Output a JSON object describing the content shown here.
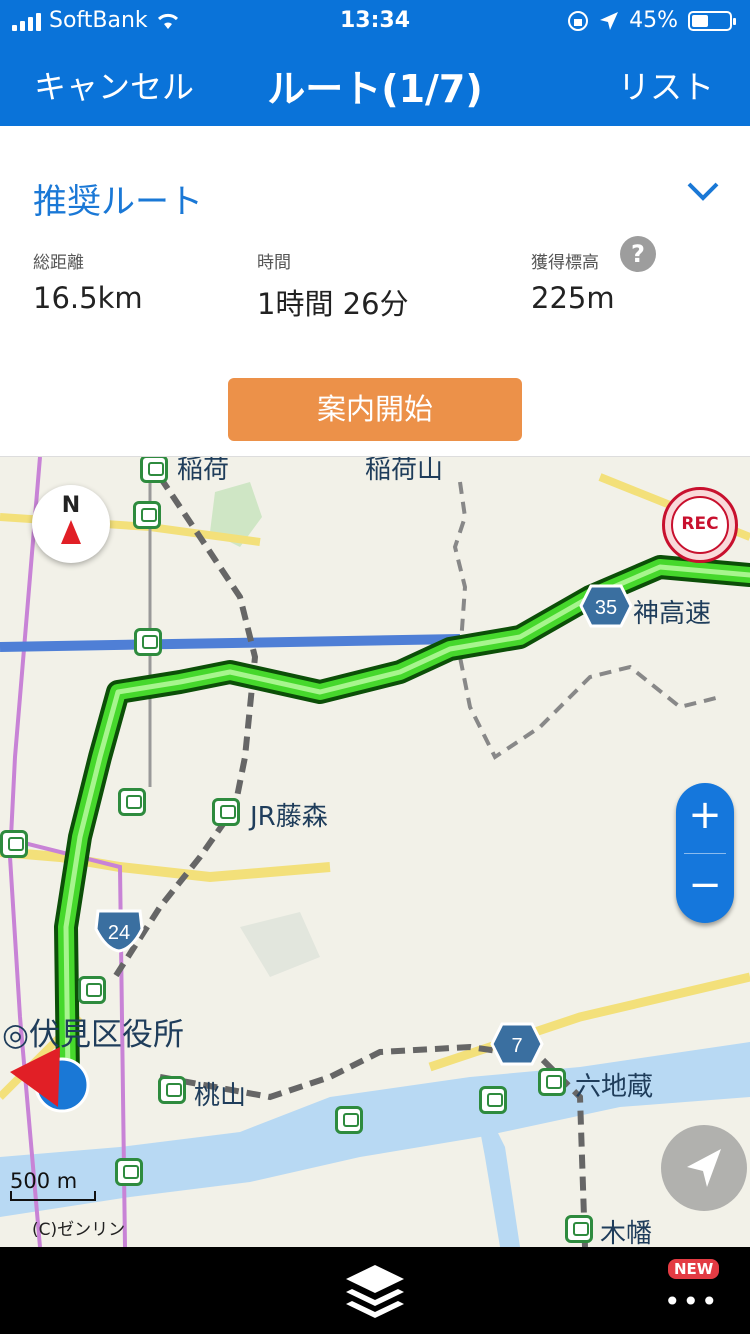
{
  "status": {
    "carrier": "SoftBank",
    "time": "13:34",
    "battery_text": "45%",
    "battery_level": 0.45
  },
  "nav": {
    "cancel": "キャンセル",
    "title": "ルート(1/7)",
    "list": "リスト"
  },
  "route": {
    "name": "推奨ルート",
    "distance_label": "総距離",
    "distance": "16.5km",
    "time_label": "時間",
    "time": "1時間 26分",
    "elevation_label": "獲得標高",
    "elevation": "225m",
    "help": "?",
    "start_button": "案内開始"
  },
  "map": {
    "compass": "N",
    "rec": "REC",
    "labels": {
      "inari": "稲荷",
      "inariyama": "稲荷山",
      "hanshin": "神高速",
      "jr_fujinomori": "JR藤森",
      "fushimi_ward": "◎伏見区役所",
      "momoyama": "桃山",
      "rokujizo": "六地蔵",
      "kohata": "木幡"
    },
    "routes": {
      "r35": "35",
      "r24": "24",
      "r7": "7"
    },
    "scale": "500 m",
    "copyright": "(C)ゼンリン",
    "zoom_in": "+",
    "zoom_out": "−",
    "colors": {
      "route": "#46d82c",
      "accent": "#0a73d9",
      "start_button": "#ec9149"
    }
  },
  "toolbar": {
    "new_badge": "NEW",
    "more": "•••"
  }
}
